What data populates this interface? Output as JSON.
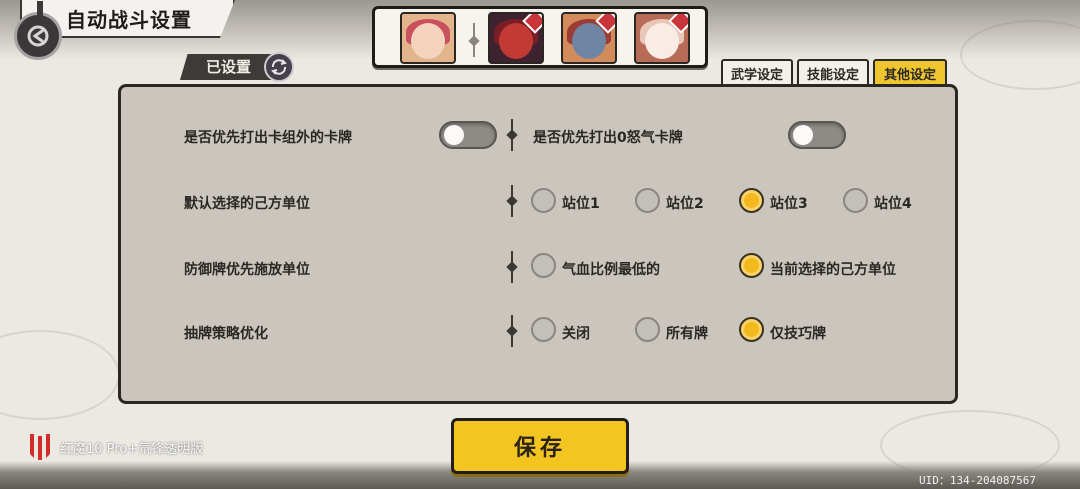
{
  "header": {
    "title": "自动战斗设置"
  },
  "team": {
    "portraits": [
      {
        "icon": "hero-portrait",
        "hair": "#c9505e",
        "face": "#f3d3bd",
        "bg": "#e3b58c"
      },
      {
        "icon": "demon-card-portrait",
        "hair": "#7a1e25",
        "face": "#c33a35",
        "bg": "#3e2230",
        "badge": true
      },
      {
        "icon": "beast-card-portrait",
        "hair": "#9b3d34",
        "face": "#6e85a3",
        "bg": "#d48b5c",
        "badge": true
      },
      {
        "icon": "spirit-card-portrait",
        "hair": "#e9c7b6",
        "face": "#f8ece4",
        "bg": "#b86b57",
        "badge": true
      }
    ]
  },
  "config_label": "已设置",
  "tabs": [
    {
      "label": "武学设定",
      "active": false
    },
    {
      "label": "技能设定",
      "active": false
    },
    {
      "label": "其他设定",
      "active": true
    }
  ],
  "settings": {
    "row1": {
      "left_label": "是否优先打出卡组外的卡牌",
      "left_toggle": "off",
      "right_label": "是否优先打出0怒气卡牌",
      "right_toggle": "off"
    },
    "row2": {
      "label": "默认选择的己方单位",
      "options": [
        "站位1",
        "站位2",
        "站位3",
        "站位4"
      ],
      "selected": "站位3"
    },
    "row3": {
      "label": "防御牌优先施放单位",
      "options": [
        "气血比例最低的",
        "当前选择的己方单位"
      ],
      "selected": "当前选择的己方单位"
    },
    "row4": {
      "label": "抽牌策略优化",
      "options": [
        "关闭",
        "所有牌",
        "仅技巧牌"
      ],
      "selected": "仅技巧牌"
    }
  },
  "save_label": "保存",
  "watermark": "红魔10 Pro+氘锋透明版",
  "uid": "UID：134-204087567",
  "colors": {
    "accent": "#f2c521",
    "radio_on": "#f2b81d",
    "panel": "#cac5bd"
  }
}
